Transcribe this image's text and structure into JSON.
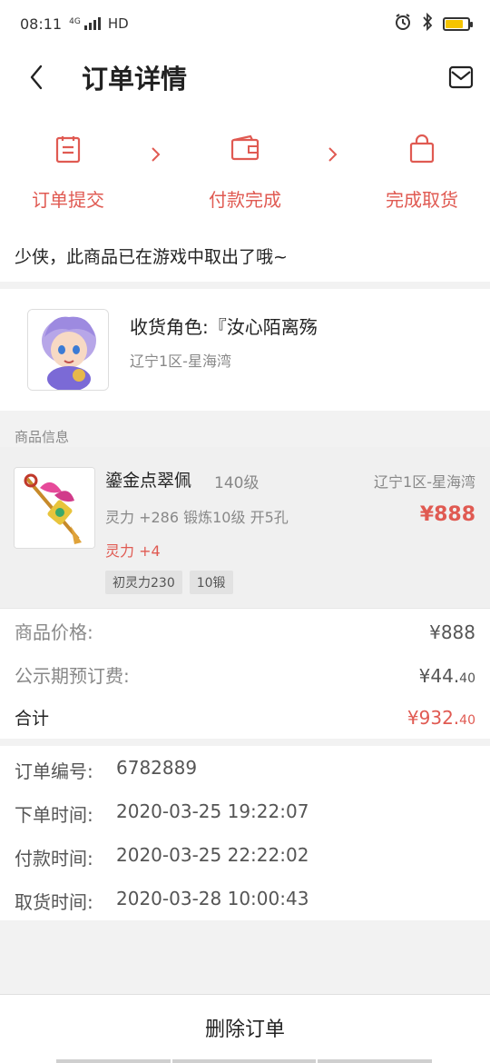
{
  "status_bar": {
    "time": "08:11",
    "network": "4G",
    "hd": "HD",
    "icons": [
      "signal-icon",
      "alarm-icon",
      "bluetooth-icon",
      "battery-icon"
    ]
  },
  "header": {
    "title": "订单详情",
    "icons": {
      "back": "chevron-left-icon",
      "mail": "mail-icon"
    }
  },
  "steps": [
    {
      "label": "订单提交",
      "icon": "clipboard-icon"
    },
    {
      "label": "付款完成",
      "icon": "wallet-icon"
    },
    {
      "label": "完成取货",
      "icon": "bag-icon"
    }
  ],
  "notice": "少侠，此商品已在游戏中取出了哦~",
  "receiver": {
    "label": "收货角色:",
    "name": "『汝心陌离殇",
    "server": "辽宁1区-星海湾"
  },
  "goods_section_label": "商品信息",
  "goods": {
    "name": "鎏金点翠佩",
    "level": "140级",
    "server": "辽宁1区-星海湾",
    "attr": "灵力 +286 锻炼10级 开5孔",
    "price": "¥888",
    "bonus": "灵力 +4",
    "tags": [
      "初灵力230",
      "10锻"
    ]
  },
  "prices": {
    "goods_price_label": "商品价格:",
    "goods_price_value": "¥888",
    "fee_label": "公示期预订费:",
    "fee_main": "¥44.",
    "fee_cents": "40",
    "total_label": "合计",
    "total_main": "¥932.",
    "total_cents": "40"
  },
  "order": {
    "number_label": "订单编号:",
    "number": "6782889",
    "order_time_label": "下单时间:",
    "order_time": "2020-03-25 19:22:07",
    "pay_time_label": "付款时间:",
    "pay_time": "2020-03-25 22:22:02",
    "pickup_time_label": "取货时间:",
    "pickup_time": "2020-03-28 10:00:43"
  },
  "bottom": {
    "delete_label": "删除订单"
  },
  "colors": {
    "accent": "#e05a52",
    "background": "#f2f2f2",
    "muted_text": "#888888"
  }
}
